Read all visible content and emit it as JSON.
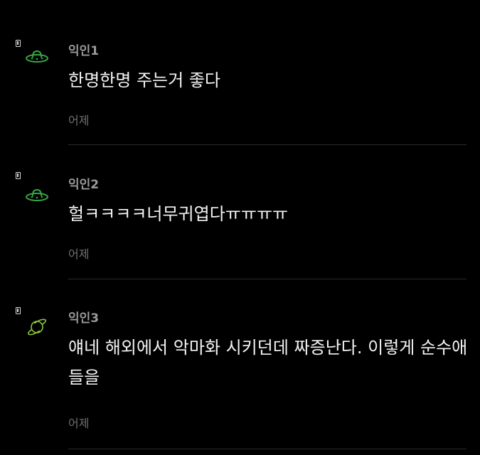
{
  "comments": [
    {
      "author": "익인1",
      "text": "한명한명 주는거 좋다",
      "time": "어제",
      "avatar_icon": "ufo-icon",
      "avatar_color": "#35a845"
    },
    {
      "author": "익인2",
      "text": "헐ㅋㅋㅋㅋ너무귀엽다ㅠㅠㅠㅠ",
      "time": "어제",
      "avatar_icon": "ufo-icon",
      "avatar_color": "#35a845"
    },
    {
      "author": "익인3",
      "text": "얘네 해외에서 악마화 시키던데 짜증난다. 이렇게 순수애들을",
      "time": "어제",
      "avatar_icon": "planet-icon",
      "avatar_color": "#8cc63f"
    }
  ]
}
